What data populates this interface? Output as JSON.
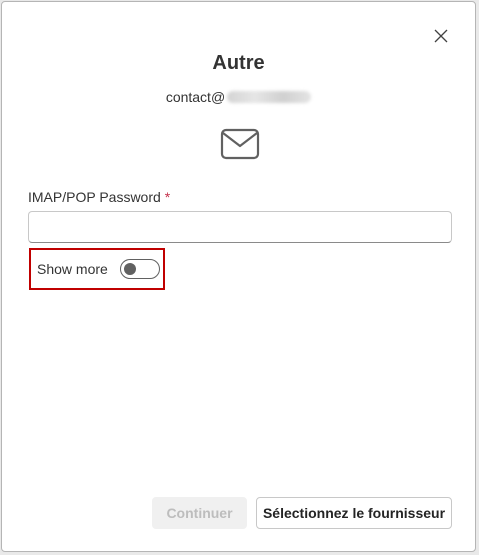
{
  "dialog": {
    "title": "Autre",
    "email_prefix": "contact@",
    "close_icon": "close-icon",
    "mail_icon": "mail-icon"
  },
  "form": {
    "password_label": "IMAP/POP Password",
    "required_marker": "*",
    "password_value": "",
    "show_more_label": "Show more",
    "show_more_on": false
  },
  "buttons": {
    "continue_label": "Continuer",
    "continue_disabled": true,
    "provider_label": "Sélectionnez le fournisseur"
  },
  "colors": {
    "required": "#c4314b",
    "highlight_border": "#c00000",
    "toggle_off": "#616161"
  }
}
